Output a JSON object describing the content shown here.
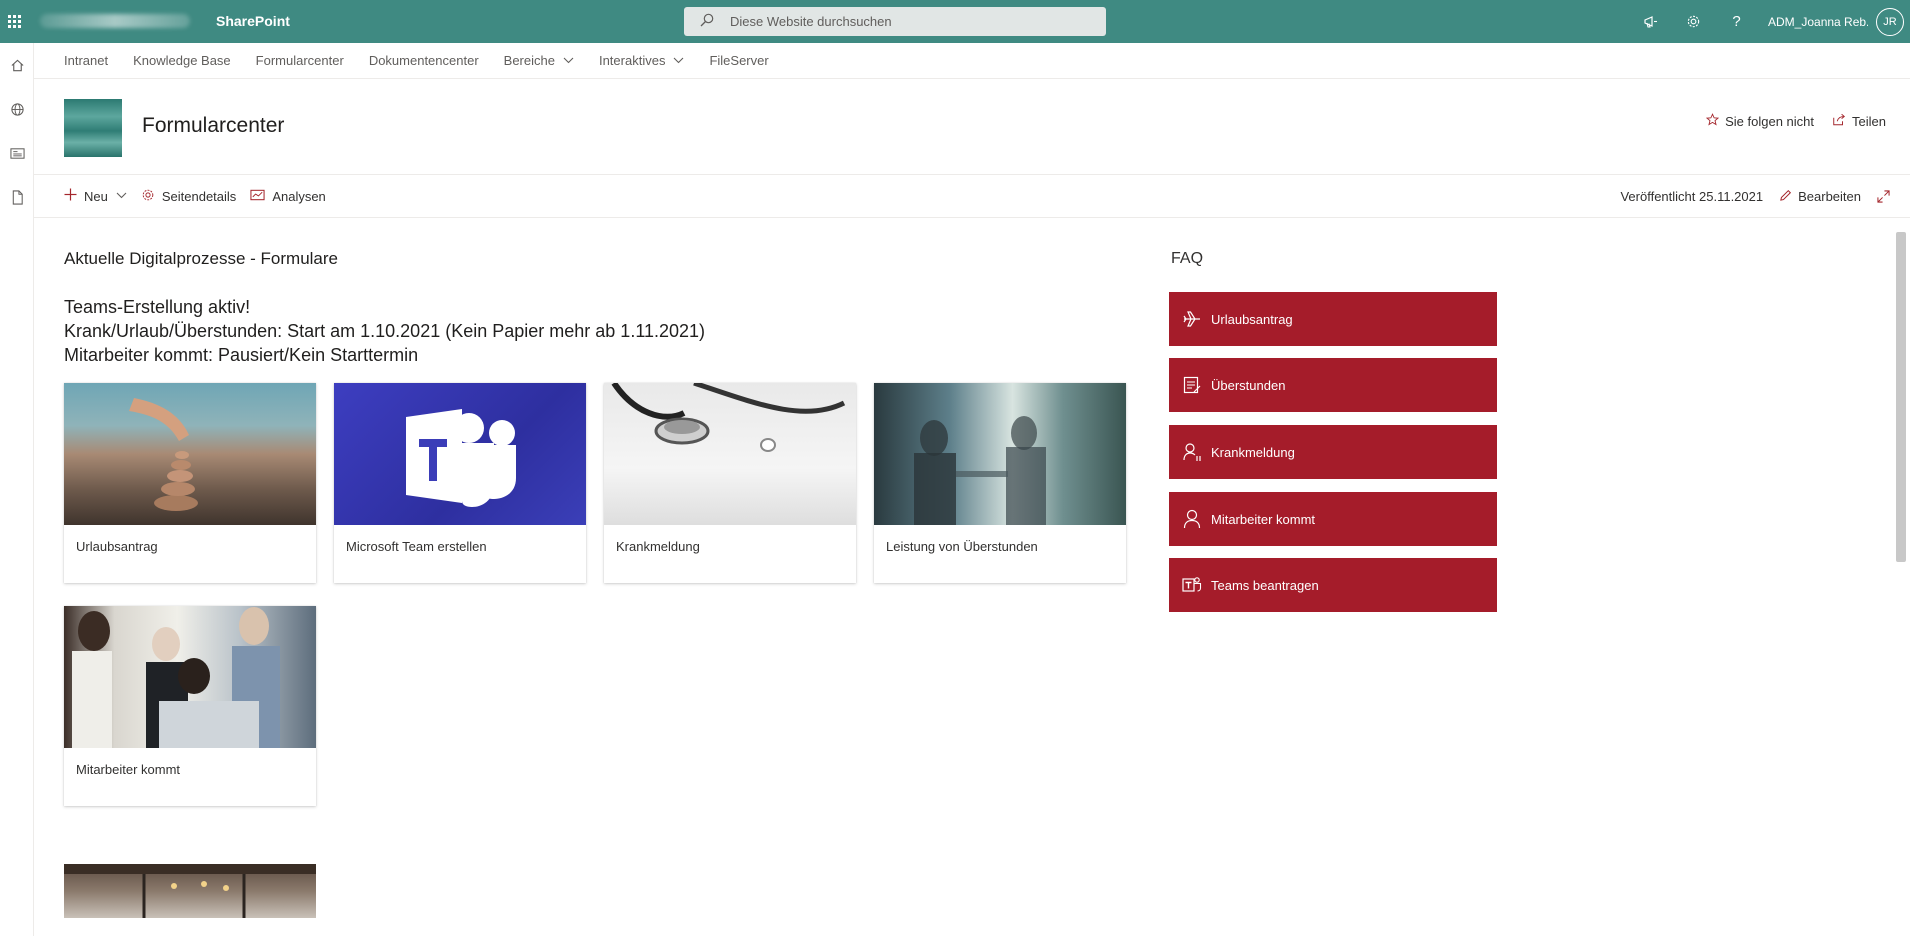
{
  "suite": {
    "app_name": "SharePoint",
    "search_placeholder": "Diese Website durchsuchen",
    "user_name": "ADM_Joanna Reb...",
    "user_initials": "JR",
    "help_glyph": "?"
  },
  "hubnav": {
    "items": [
      {
        "label": "Intranet"
      },
      {
        "label": "Knowledge Base"
      },
      {
        "label": "Formularcenter"
      },
      {
        "label": "Dokumentencenter"
      },
      {
        "label": "Bereiche"
      },
      {
        "label": "Interaktives"
      },
      {
        "label": "FileServer"
      }
    ]
  },
  "site": {
    "title": "Formularcenter",
    "follow_label": "Sie folgen nicht",
    "share_label": "Teilen"
  },
  "commandbar": {
    "new_label": "Neu",
    "details_label": "Seitendetails",
    "analytics_label": "Analysen",
    "published_label": "Veröffentlicht 25.11.2021",
    "edit_label": "Bearbeiten"
  },
  "main": {
    "section_title": "Aktuelle Digitalprozesse - Formulare",
    "announcements": [
      "Teams-Erstellung aktiv!",
      "Krank/Urlaub/Überstunden: Start am 1.10.2021 (Kein Papier mehr ab 1.11.2021)",
      "Mitarbeiter kommt: Pausiert/Kein Starttermin"
    ],
    "cards": [
      {
        "label": "Urlaubsantrag"
      },
      {
        "label": "Microsoft Team erstellen"
      },
      {
        "label": "Krankmeldung"
      },
      {
        "label": "Leistung von Überstunden"
      },
      {
        "label": "Mitarbeiter kommt"
      }
    ]
  },
  "faq": {
    "title": "FAQ",
    "buttons": [
      {
        "label": "Urlaubsantrag",
        "icon": "airplane-icon"
      },
      {
        "label": "Überstunden",
        "icon": "timesheet-icon"
      },
      {
        "label": "Krankmeldung",
        "icon": "person-sick-icon"
      },
      {
        "label": "Mitarbeiter kommt",
        "icon": "person-icon"
      },
      {
        "label": "Teams beantragen",
        "icon": "teams-icon"
      }
    ]
  },
  "colors": {
    "suite_bar": "#3f8a82",
    "faq_button": "#a51c2a",
    "accent_icon": "#a4262c"
  }
}
